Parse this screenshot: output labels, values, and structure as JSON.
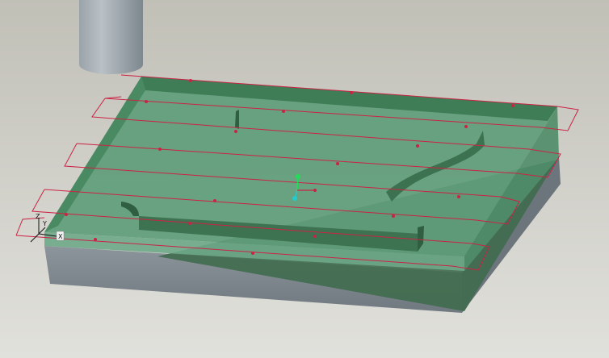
{
  "viewport": {
    "background_top": "#c1c0b7",
    "background_bottom": "#e1e1dc"
  },
  "model": {
    "block_top_color": "#5f9d79",
    "block_edge_color": "#3f7a53",
    "block_side_color": "#7c858c",
    "block_side_dark_color": "#5e676e",
    "slanted_face_color": "#3f6b4e"
  },
  "tool": {
    "name": "cutter",
    "color": "#8e989f"
  },
  "toolpath": {
    "color": "#cc2244",
    "passes": 8
  },
  "coordinate_triad": {
    "axes": [
      "Z",
      "Y",
      "X"
    ],
    "icon": "axis-triad-icon"
  },
  "pivot_marker": {
    "colors": [
      "#22dd55",
      "#22cccc"
    ],
    "icon": "spin-center-icon"
  }
}
